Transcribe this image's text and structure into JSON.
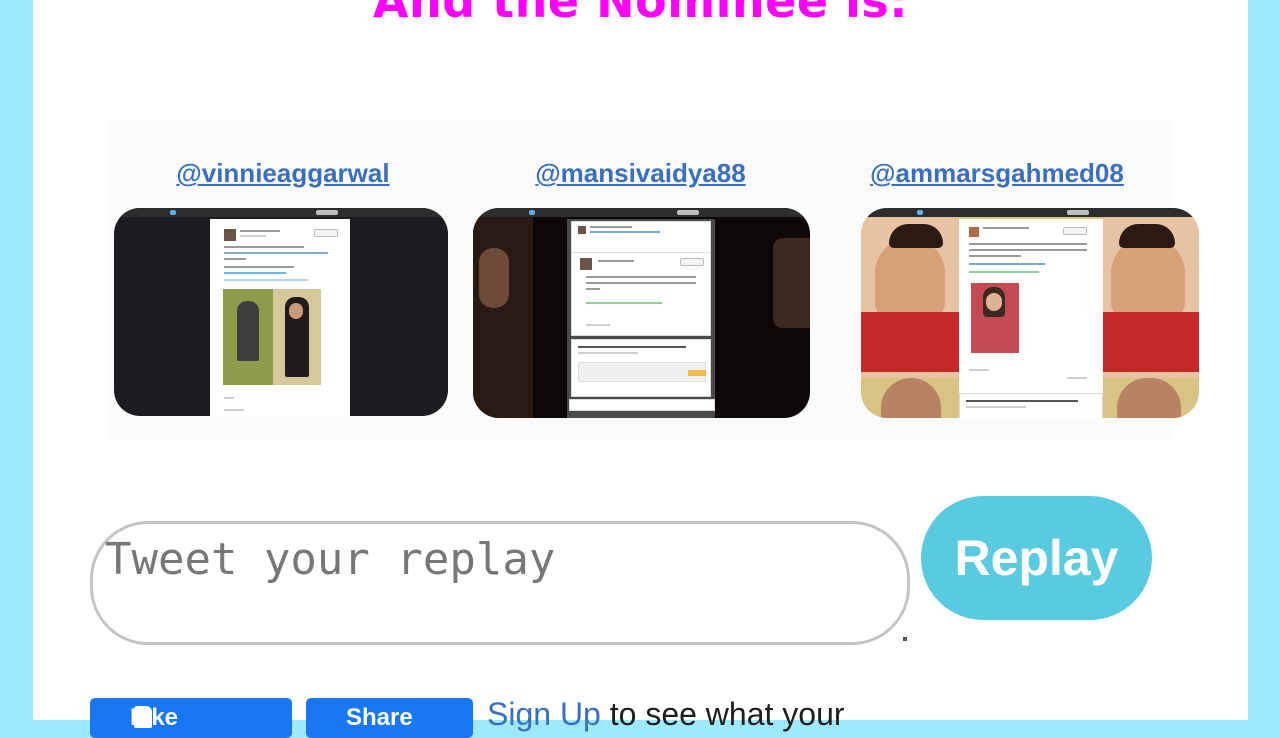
{
  "headline": "And the Nominee is:",
  "nominees": [
    {
      "handle": "@vinnieaggarwal"
    },
    {
      "handle": "@mansivaidya88"
    },
    {
      "handle": "@ammarsgahmed08"
    }
  ],
  "reply": {
    "placeholder": "Tweet your replay",
    "button_label": "Replay"
  },
  "facebook": {
    "like_label": "Like",
    "share_label": "Share",
    "signup_link": "Sign Up",
    "signup_rest": "to see what your"
  },
  "colors": {
    "headline": "#ff00ff",
    "link": "#3a6fc0",
    "reply_button": "#58cbe0",
    "facebook_blue": "#1877f2",
    "side_background": "#9ee9fb"
  }
}
